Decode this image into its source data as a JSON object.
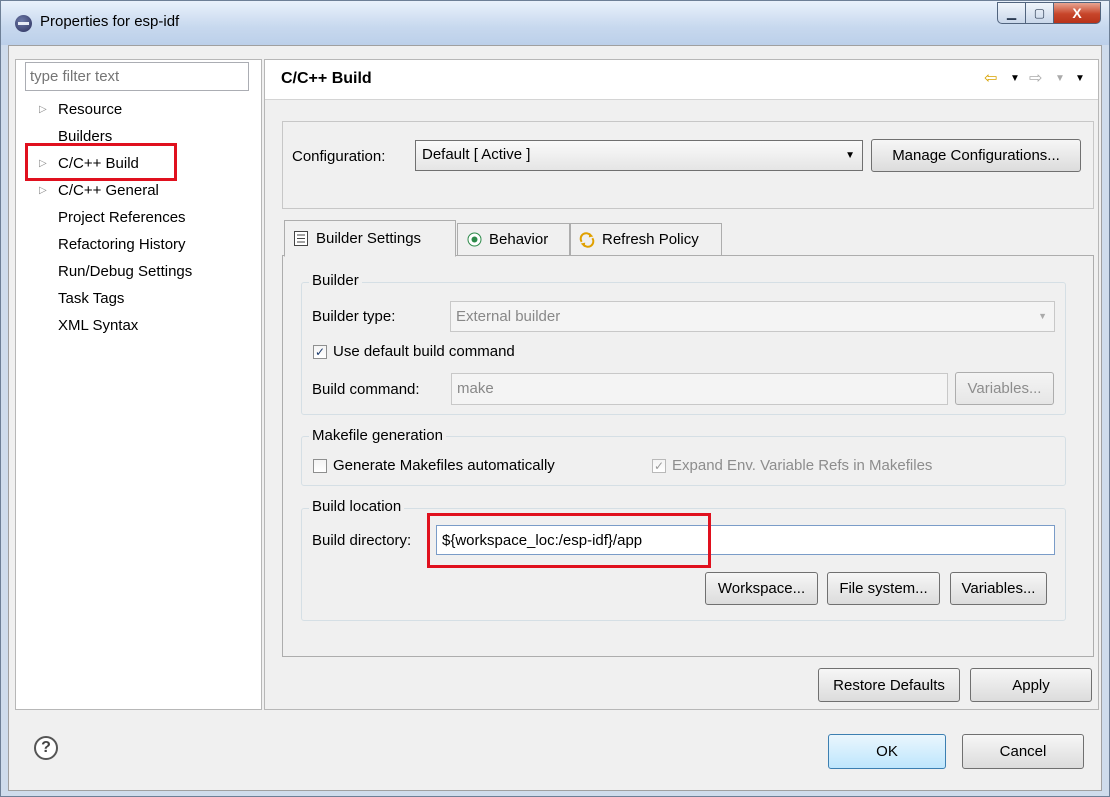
{
  "window": {
    "title": "Properties for esp-idf",
    "minimize_label": "▁",
    "maximize_label": "▢",
    "close_label": "X"
  },
  "sidebar": {
    "filter_placeholder": "type filter text",
    "items": [
      {
        "label": "Resource",
        "expandable": true
      },
      {
        "label": "Builders",
        "expandable": false
      },
      {
        "label": "C/C++ Build",
        "expandable": true,
        "selected": true
      },
      {
        "label": "C/C++ General",
        "expandable": true
      },
      {
        "label": "Project References",
        "expandable": false
      },
      {
        "label": "Refactoring History",
        "expandable": false
      },
      {
        "label": "Run/Debug Settings",
        "expandable": false
      },
      {
        "label": "Task Tags",
        "expandable": false
      },
      {
        "label": "XML Syntax",
        "expandable": false
      }
    ]
  },
  "page": {
    "title": "C/C++ Build",
    "configuration_label": "Configuration:",
    "configuration_value": "Default  [ Active ]",
    "manage_button": "Manage Configurations..."
  },
  "tabs": [
    {
      "label": "Builder Settings",
      "icon": "list-icon",
      "active": true
    },
    {
      "label": "Behavior",
      "icon": "radio-icon",
      "active": false
    },
    {
      "label": "Refresh Policy",
      "icon": "refresh-icon",
      "active": false
    }
  ],
  "builder": {
    "group_label": "Builder",
    "type_label": "Builder type:",
    "type_value": "External builder",
    "use_default_label": "Use default build command",
    "use_default_checked": true,
    "command_label": "Build command:",
    "command_value": "make",
    "variables_button": "Variables..."
  },
  "makefile": {
    "group_label": "Makefile generation",
    "generate_label": "Generate Makefiles automatically",
    "generate_checked": false,
    "expand_label": "Expand Env. Variable Refs in Makefiles",
    "expand_checked": true
  },
  "location": {
    "group_label": "Build location",
    "directory_label": "Build directory:",
    "directory_value": "${workspace_loc:/esp-idf}/app",
    "workspace_button": "Workspace...",
    "filesystem_button": "File system...",
    "variables_button": "Variables..."
  },
  "footer": {
    "restore_button": "Restore Defaults",
    "apply_button": "Apply",
    "ok_button": "OK",
    "cancel_button": "Cancel",
    "help_label": "?"
  },
  "colors": {
    "highlight": "#e0101e",
    "accent": "#3c7fb1"
  }
}
